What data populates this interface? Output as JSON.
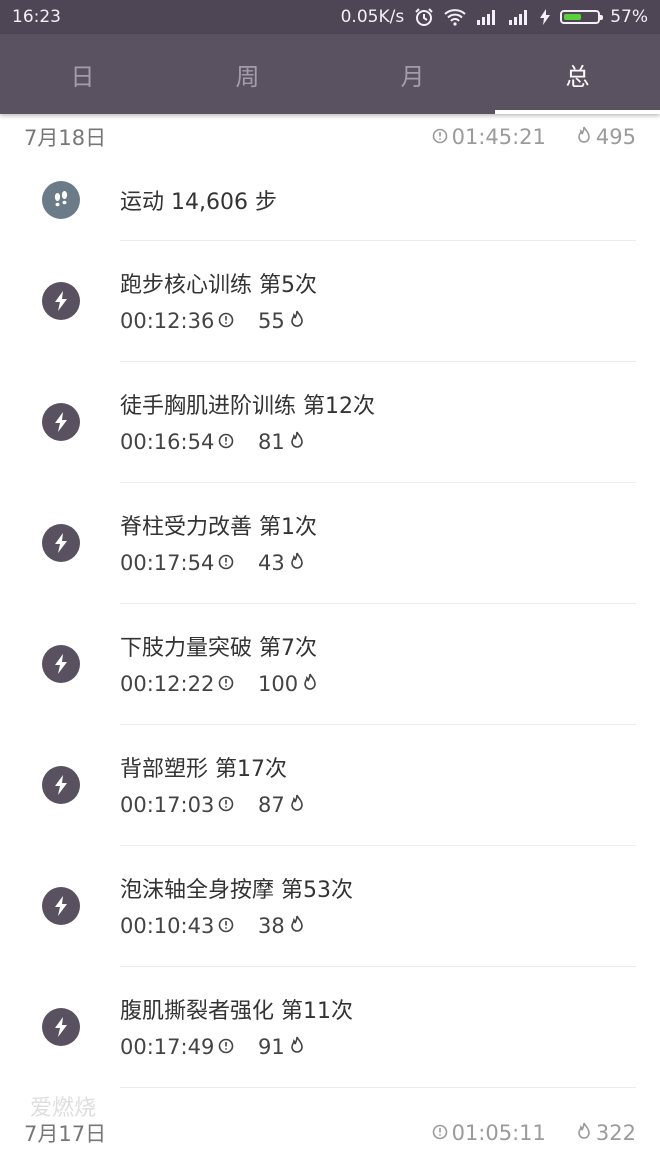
{
  "status_bar": {
    "time": "16:23",
    "network_speed": "0.05K/s",
    "battery_percent": "57%",
    "battery_level": 0.57,
    "icons": [
      "alarm-icon",
      "wifi-icon",
      "signal-icon",
      "signal-icon",
      "charging-icon",
      "battery-icon"
    ]
  },
  "tabs": [
    {
      "label": "日",
      "active": false
    },
    {
      "label": "周",
      "active": false
    },
    {
      "label": "月",
      "active": false
    },
    {
      "label": "总",
      "active": true
    }
  ],
  "days": [
    {
      "date": "7月18日",
      "total_duration": "01:45:21",
      "total_calories": "495",
      "steps_label": "运动 14,606 步",
      "workouts": [
        {
          "title": "跑步核心训练 第5次",
          "duration": "00:12:36",
          "calories": "55"
        },
        {
          "title": "徒手胸肌进阶训练 第12次",
          "duration": "00:16:54",
          "calories": "81"
        },
        {
          "title": "脊柱受力改善 第1次",
          "duration": "00:17:54",
          "calories": "43"
        },
        {
          "title": "下肢力量突破 第7次",
          "duration": "00:12:22",
          "calories": "100"
        },
        {
          "title": "背部塑形 第17次",
          "duration": "00:17:03",
          "calories": "87"
        },
        {
          "title": "泡沫轴全身按摩 第53次",
          "duration": "00:10:43",
          "calories": "38"
        },
        {
          "title": "腹肌撕裂者强化 第11次",
          "duration": "00:17:49",
          "calories": "91"
        }
      ]
    },
    {
      "date": "7月17日",
      "total_duration": "01:05:11",
      "total_calories": "322"
    }
  ],
  "watermark": "爱燃烧",
  "colors": {
    "status_bar": "#4e4654",
    "tab_bar": "#5b5261",
    "icon_circle": "#5a5160",
    "steps_circle": "#6b7b88",
    "battery_fill": "#5ad13a"
  }
}
